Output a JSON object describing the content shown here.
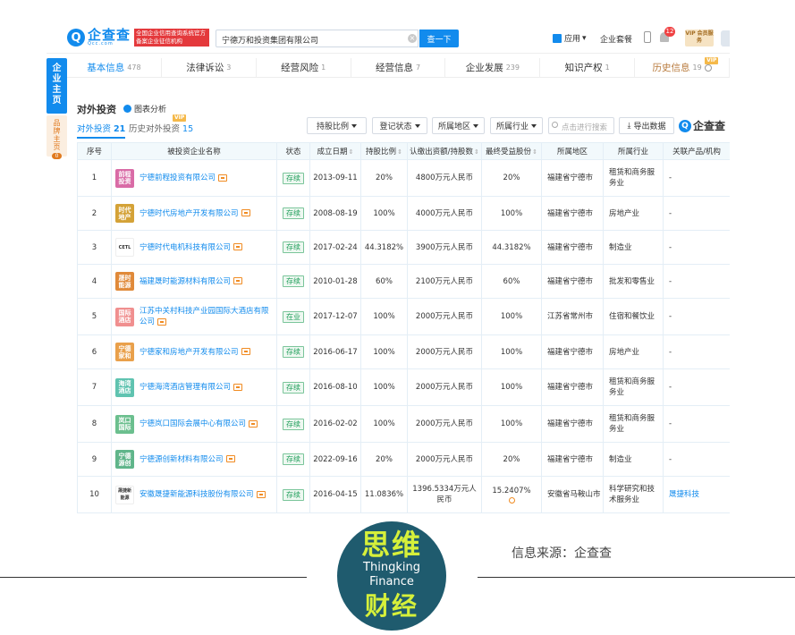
{
  "header": {
    "logo_mark": "Q",
    "logo_main": "企查查",
    "logo_sub": "Qcc.com",
    "logo_tag": "全国企业信用查询系统官方备案企业征信机构",
    "search_value": "宁德万和投资集团有限公司",
    "search_button": "查一下",
    "apps_label": "应用",
    "package_label": "企业套餐",
    "notification_count": "12",
    "vip_label": "VIP 会员服务"
  },
  "sidebar": {
    "main_label": "企业主页",
    "brand_label": "品牌主页",
    "brand_count": "0"
  },
  "tabs": [
    {
      "label": "基本信息",
      "count": "478"
    },
    {
      "label": "法律诉讼",
      "count": "3"
    },
    {
      "label": "经营风险",
      "count": "1"
    },
    {
      "label": "经营信息",
      "count": "7"
    },
    {
      "label": "企业发展",
      "count": "239"
    },
    {
      "label": "知识产权",
      "count": "1"
    },
    {
      "label": "历史信息",
      "count": "19",
      "badge": "VIP"
    }
  ],
  "section": {
    "title": "对外投资",
    "chart_link": "图表分析",
    "subtab_current_label": "对外投资",
    "subtab_current_count": "21",
    "subtab_history_label": "历史对外投资",
    "subtab_history_count": "15",
    "subtab_history_badge": "VIP"
  },
  "filters": {
    "share_ratio": "持股比例",
    "reg_status": "登记状态",
    "region": "所属地区",
    "industry": "所属行业",
    "search_placeholder": "点击进行搜索",
    "export": "导出数据",
    "brand_mark": "Q",
    "brand_text": "企查查"
  },
  "table": {
    "headers": [
      "序号",
      "被投资企业名称",
      "状态",
      "成立日期",
      "持股比例",
      "认缴出资额/持股数",
      "最终受益股份",
      "所属地区",
      "所属行业",
      "关联产品/机构"
    ],
    "sort_mark": "⇕",
    "rows": [
      {
        "no": "1",
        "logo": "前程投资",
        "logo_color": "#d96ba6",
        "name": "宁德前程投资有限公司",
        "status": "存续",
        "date": "2013-09-11",
        "ratio": "20%",
        "capital": "4800万元人民币",
        "benefit": "20%",
        "region": "福建省宁德市",
        "industry": "租赁和商务服务业",
        "related": "-"
      },
      {
        "no": "2",
        "logo": "时代地产",
        "logo_color": "#d4a237",
        "name": "宁德时代房地产开发有限公司",
        "status": "存续",
        "date": "2008-08-19",
        "ratio": "100%",
        "capital": "4000万元人民币",
        "benefit": "100%",
        "region": "福建省宁德市",
        "industry": "房地产业",
        "related": "-"
      },
      {
        "no": "3",
        "logo": "CETL",
        "logo_color": "img",
        "name": "宁德时代电机科技有限公司",
        "status": "存续",
        "date": "2017-02-24",
        "ratio": "44.3182%",
        "capital": "3900万元人民币",
        "benefit": "44.3182%",
        "region": "福建省宁德市",
        "industry": "制造业",
        "related": "-"
      },
      {
        "no": "4",
        "logo": "晟时能源",
        "logo_color": "#e08a3a",
        "name": "福建晟时能源材料有限公司",
        "status": "存续",
        "date": "2010-01-28",
        "ratio": "60%",
        "capital": "2100万元人民币",
        "benefit": "60%",
        "region": "福建省宁德市",
        "industry": "批发和零售业",
        "related": "-"
      },
      {
        "no": "5",
        "logo": "国际酒店",
        "logo_color": "#f08f8f",
        "name": "江苏中关村科技产业园国际大酒店有限公司",
        "status": "在业",
        "date": "2017-12-07",
        "ratio": "100%",
        "capital": "2000万元人民币",
        "benefit": "100%",
        "region": "江苏省常州市",
        "industry": "住宿和餐饮业",
        "related": "-"
      },
      {
        "no": "6",
        "logo": "宁德家和",
        "logo_color": "#e9a04b",
        "name": "宁德家和房地产开发有限公司",
        "status": "存续",
        "date": "2016-06-17",
        "ratio": "100%",
        "capital": "2000万元人民币",
        "benefit": "100%",
        "region": "福建省宁德市",
        "industry": "房地产业",
        "related": "-"
      },
      {
        "no": "7",
        "logo": "海湾酒店",
        "logo_color": "#5fc3b0",
        "name": "宁德海湾酒店管理有限公司",
        "status": "存续",
        "date": "2016-08-10",
        "ratio": "100%",
        "capital": "2000万元人民币",
        "benefit": "100%",
        "region": "福建省宁德市",
        "industry": "租赁和商务服务业",
        "related": "-"
      },
      {
        "no": "8",
        "logo": "岚口国际",
        "logo_color": "#6bbf8e",
        "name": "宁德岚口国际会展中心有限公司",
        "status": "存续",
        "date": "2016-02-02",
        "ratio": "100%",
        "capital": "2000万元人民币",
        "benefit": "100%",
        "region": "福建省宁德市",
        "industry": "租赁和商务服务业",
        "related": "-"
      },
      {
        "no": "9",
        "logo": "宁德源创",
        "logo_color": "#5fb58a",
        "name": "宁德源创新材料有限公司",
        "status": "存续",
        "date": "2022-09-16",
        "ratio": "20%",
        "capital": "2000万元人民币",
        "benefit": "20%",
        "region": "福建省宁德市",
        "industry": "制造业",
        "related": "-"
      },
      {
        "no": "10",
        "logo": "晟捷新能源",
        "logo_color": "img",
        "name": "安徽晟捷新能源科技股份有限公司",
        "status": "存续",
        "date": "2016-04-15",
        "ratio": "11.0836%",
        "capital": "1396.5334万元人民币",
        "benefit": "15.2407%",
        "region": "安徽省马鞍山市",
        "industry": "科学研究和技术服务业",
        "related": "晟捷科技"
      }
    ]
  },
  "footer": {
    "logo_cn_top": "思维",
    "logo_en_1": "Thingking",
    "logo_en_2": "Finance",
    "logo_cn_bottom": "财经",
    "source": "信息来源：企查查"
  }
}
